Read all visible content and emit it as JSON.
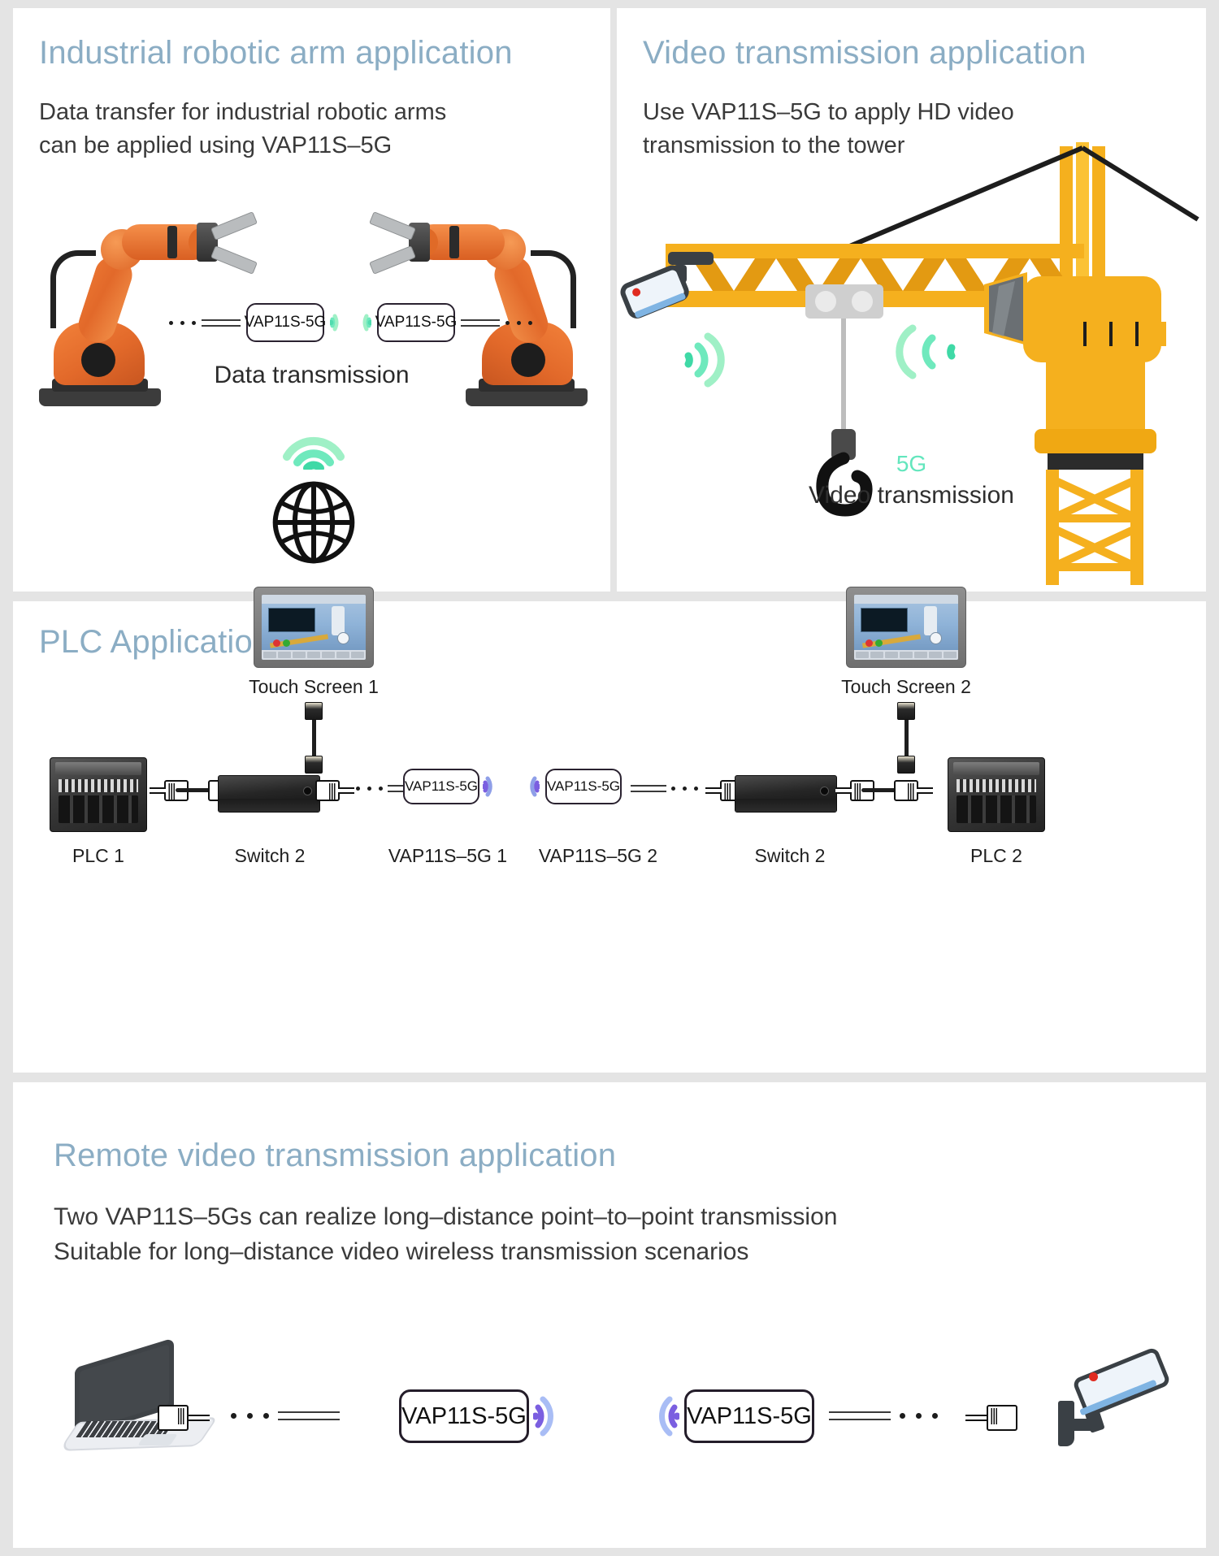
{
  "theme": {
    "page_bg": "#e4e4e4",
    "panel_bg": "#ffffff",
    "title_color": "#8badc4",
    "body_color": "#3a3a3a",
    "wifi_green": "#5fe3b4",
    "wifi_green_light": "#9ff0c6",
    "wifi_purple": "#7b5fe0",
    "wifi_purple_light": "#a9bdf5",
    "accent_5g": "#63e6bd",
    "crane_yellow": "#f5b01e",
    "robot_orange": "#e2692a"
  },
  "panels": {
    "robotic": {
      "title": "Industrial robotic arm application",
      "body_line1": "Data transfer for industrial robotic arms",
      "body_line2": "can be applied using VAP11S–5G",
      "device_left": "VAP11S-5G",
      "device_right": "VAP11S-5G",
      "caption": "Data transmission",
      "globe_icon": "globe-icon",
      "wifi_icon": "wifi-icon"
    },
    "video": {
      "title": "Video transmission application",
      "body_line1": "Use VAP11S–5G to apply HD video",
      "body_line2": "transmission to the tower",
      "badge_5g": "5G",
      "caption": "Video transmission",
      "crane_icon": "tower-crane-icon",
      "camera_icon": "cctv-camera-icon"
    },
    "plc": {
      "title": "PLC Application",
      "nodes_left": [
        {
          "label": "PLC 1",
          "icon": "plc-unit-icon"
        },
        {
          "label": "Switch 2",
          "icon": "network-switch-icon"
        },
        {
          "label": "VAP11S–5G 1",
          "icon": "vap-device-icon",
          "device_text": "VAP11S-5G"
        }
      ],
      "nodes_right": [
        {
          "label": "VAP11S–5G 2",
          "icon": "vap-device-icon",
          "device_text": "VAP11S-5G"
        },
        {
          "label": "Switch 2",
          "icon": "network-switch-icon"
        },
        {
          "label": "PLC 2",
          "icon": "plc-unit-icon"
        }
      ],
      "screen_left": {
        "label": "Touch Screen 1",
        "icon": "hmi-touch-screen-icon"
      },
      "screen_right": {
        "label": "Touch Screen 2",
        "icon": "hmi-touch-screen-icon"
      }
    },
    "remote": {
      "title": "Remote video transmission application",
      "body_line1": "Two VAP11S–5Gs can realize long–distance point–to–point transmission",
      "body_line2": "Suitable for long–distance video wireless transmission scenarios",
      "device_left": "VAP11S-5G",
      "device_right": "VAP11S-5G",
      "laptop_icon": "laptop-icon",
      "camera_icon": "cctv-camera-icon",
      "connector_icon": "rj45-connector-icon"
    }
  }
}
